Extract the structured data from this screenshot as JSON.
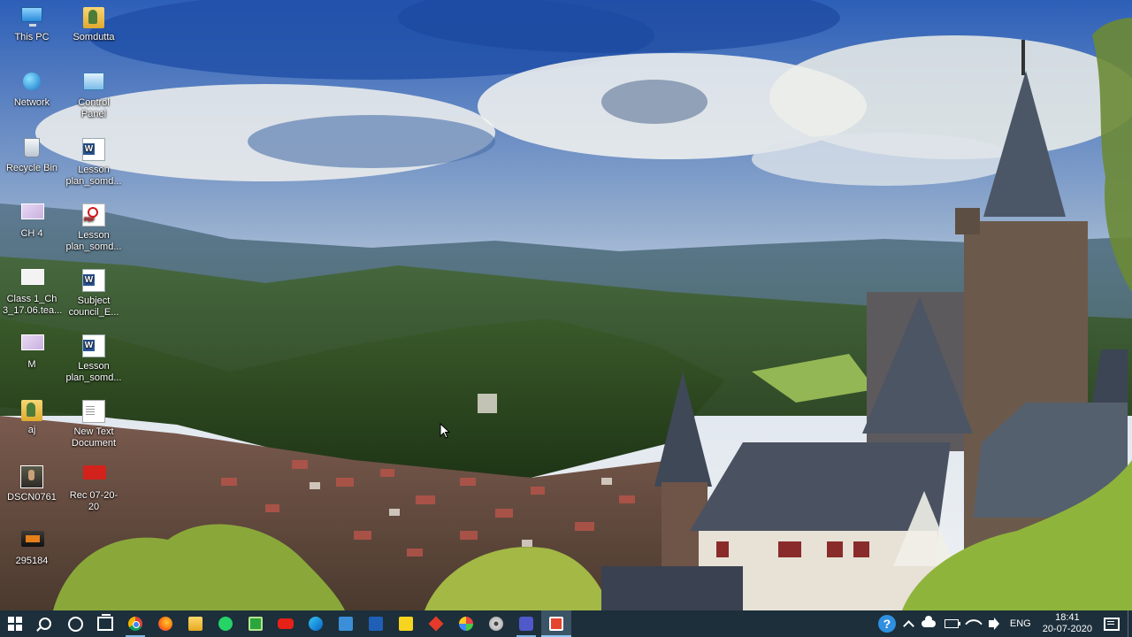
{
  "desktop": {
    "icons": [
      {
        "label": "This PC",
        "icon": "this-pc-icon"
      },
      {
        "label": "Somdutta",
        "icon": "user-folder-icon"
      },
      {
        "label": "Network",
        "icon": "network-icon"
      },
      {
        "label": "Control\nPanel",
        "icon": "control-panel-icon"
      },
      {
        "label": "Recycle Bin",
        "icon": "recycle-bin-icon"
      },
      {
        "label": "Lesson\nplan_somd...",
        "icon": "word-document-icon"
      },
      {
        "label": "CH 4",
        "icon": "image-file-icon"
      },
      {
        "label": "Lesson\nplan_somd...",
        "icon": "pdf-document-icon"
      },
      {
        "label": "Class 1_Ch\n3_17.06.tea...",
        "icon": "image-file-icon"
      },
      {
        "label": "Subject\ncouncil_E...",
        "icon": "word-document-icon"
      },
      {
        "label": "M",
        "icon": "image-file-icon"
      },
      {
        "label": "Lesson\nplan_somd...",
        "icon": "word-document-icon"
      },
      {
        "label": "aj",
        "icon": "user-folder-icon"
      },
      {
        "label": "New Text\nDocument",
        "icon": "text-document-icon"
      },
      {
        "label": "DSCN0761",
        "icon": "photo-icon"
      },
      {
        "label": "Rec 07-20-20",
        "icon": "recording-icon"
      },
      {
        "label": "295184",
        "icon": "video-file-icon"
      }
    ]
  },
  "taskbar": {
    "apps": [
      {
        "name": "chrome-icon",
        "state": "running"
      },
      {
        "name": "firefox-icon",
        "state": "normal"
      },
      {
        "name": "file-explorer-icon",
        "state": "normal"
      },
      {
        "name": "whatsapp-icon",
        "state": "normal"
      },
      {
        "name": "camtasia-icon",
        "state": "normal"
      },
      {
        "name": "youtube-icon",
        "state": "normal"
      },
      {
        "name": "edge-icon",
        "state": "normal"
      },
      {
        "name": "zoom-app-icon",
        "state": "normal"
      },
      {
        "name": "mail-icon",
        "state": "normal"
      },
      {
        "name": "sticky-notes-icon",
        "state": "normal"
      },
      {
        "name": "red-app-icon",
        "state": "normal"
      },
      {
        "name": "paint-app-icon",
        "state": "normal"
      },
      {
        "name": "media-player-icon",
        "state": "normal"
      },
      {
        "name": "teams-icon",
        "state": "running"
      },
      {
        "name": "screen-recorder-icon",
        "state": "active"
      }
    ],
    "tray": {
      "help": "?",
      "language": "ENG",
      "time": "18:41",
      "date": "20-07-2020"
    }
  },
  "colors": {
    "taskbar_bg": "#1c2f3b",
    "accent": "#7fb7e6"
  }
}
